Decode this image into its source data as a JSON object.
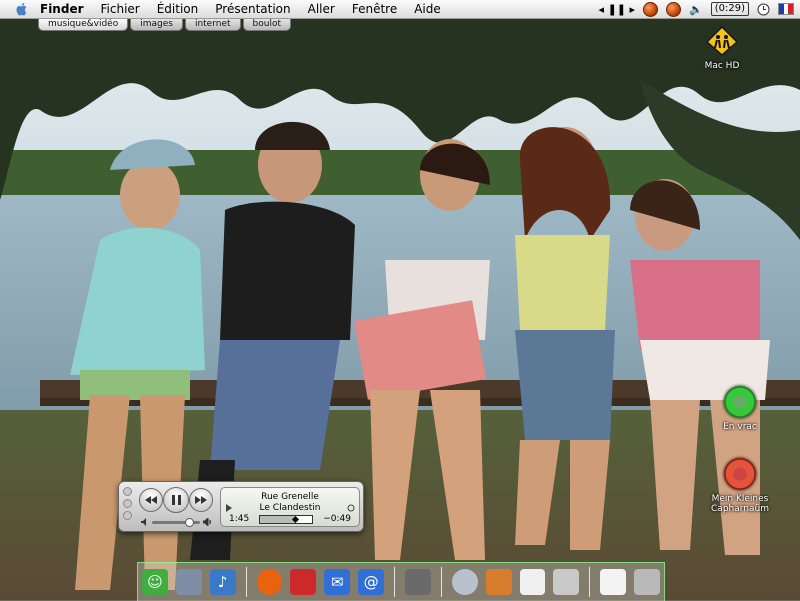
{
  "menubar": {
    "apple_icon": "apple-logo-icon",
    "items": [
      "Finder",
      "Fichier",
      "Édition",
      "Présentation",
      "Aller",
      "Fenêtre",
      "Aide"
    ],
    "status": {
      "battery_text": "(0:29)",
      "icons": [
        "play-pause-icon",
        "orange-orb-icon",
        "orange-orb-icon",
        "volume-icon",
        "battery-icon",
        "clock-icon",
        "french-flag-icon"
      ]
    }
  },
  "tabs": [
    {
      "label": "musique&vidéo",
      "active": true
    },
    {
      "label": "images",
      "active": false
    },
    {
      "label": "internet",
      "active": false
    },
    {
      "label": "boulot",
      "active": false
    }
  ],
  "desktop_icons": {
    "hd": {
      "label": "Mac HD",
      "icon": "hard-drive-warning-icon"
    },
    "vrac": {
      "label": "En vrac",
      "icon": "green-ring-folder-icon"
    },
    "caph_line1": "Mein Kleines",
    "caph_line2": "Capharnaüm",
    "caph_icon": "red-ring-folder-icon"
  },
  "player": {
    "track": "Rue Grenelle",
    "artist": "Le Clandestin",
    "elapsed": "1:45",
    "remaining": "−0:49",
    "progress": 0.68,
    "volume": 0.78
  },
  "dock": {
    "items": [
      "finder-icon",
      "mac-pro-icon",
      "itunes-swirl-icon",
      "firefox-icon",
      "transmission-icon",
      "mail-icon",
      "address-book-icon",
      "preview-icon",
      "quicktime-icon",
      "photo-icon",
      "textedit-icon",
      "image-viewer-icon",
      "stickies-icon",
      "trash-icon"
    ],
    "colors": [
      "#3fae3f",
      "#7d8ea6",
      "#3a78c8",
      "#e8620f",
      "#cc2a2a",
      "#2f6fd6",
      "#2f6fd6",
      "#6a6a6a",
      "#b8c2cf",
      "#d87c2e",
      "#f0f0f0",
      "#c9c9c9",
      "#f3f3f3",
      "#b9b9b9"
    ]
  }
}
